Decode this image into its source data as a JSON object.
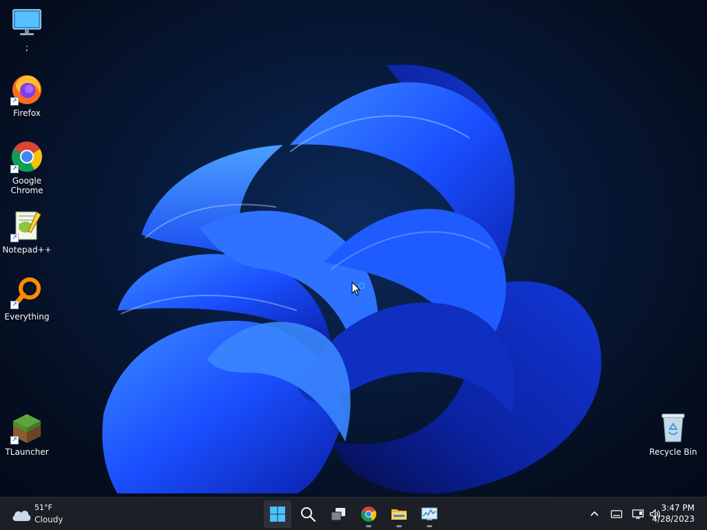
{
  "desktop": {
    "icons": [
      {
        "label": ";",
        "kind": "monitor"
      },
      {
        "label": "Firefox",
        "kind": "firefox"
      },
      {
        "label": "Google Chrome",
        "kind": "chrome"
      },
      {
        "label": "Notepad++",
        "kind": "notepadpp"
      },
      {
        "label": "Everything",
        "kind": "everything"
      },
      {
        "label": "TLauncher",
        "kind": "grass-block"
      },
      {
        "label": "Recycle Bin",
        "kind": "recycle-bin"
      }
    ],
    "shortcut_glyph": "↗"
  },
  "taskbar": {
    "weather": {
      "temperature": "51°F",
      "condition": "Cloudy",
      "icon": "cloud-icon"
    },
    "pinned": [
      {
        "name": "start",
        "icon": "windows-logo-icon"
      },
      {
        "name": "search",
        "icon": "search-icon"
      },
      {
        "name": "task-view",
        "icon": "task-view-icon"
      },
      {
        "name": "chrome",
        "icon": "chrome-icon"
      },
      {
        "name": "file-explorer",
        "icon": "folder-icon"
      },
      {
        "name": "performance-monitor",
        "icon": "monitor-chart-icon"
      }
    ],
    "tray": {
      "icons": [
        "chevron-up-icon",
        "keyboard-icon",
        "network-icon",
        "speaker-icon"
      ]
    },
    "clock": {
      "time": "3:47 PM",
      "date": "4/28/2023"
    }
  },
  "colors": {
    "taskbar_bg": "#1c1f26",
    "bloom_blue": "#1a56ff",
    "desktop_dark": "#061225"
  }
}
